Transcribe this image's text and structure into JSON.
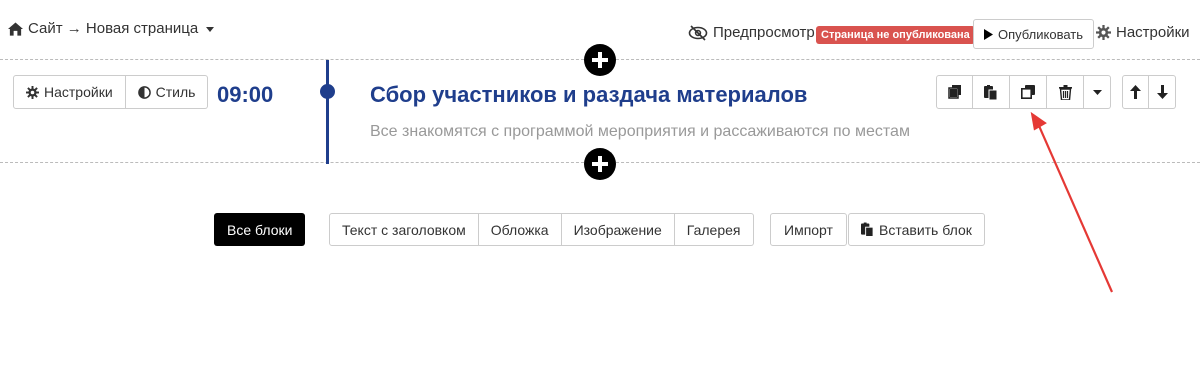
{
  "header": {
    "breadcrumb": "Сайт → Новая страница",
    "preview_label": "Предпросмотр",
    "status_badge": "Страница не опубликована",
    "publish_label": "Опубликовать",
    "settings_label": "Настройки"
  },
  "block": {
    "settings_label": "Настройки",
    "style_label": "Стиль",
    "time": "09:00",
    "title": "Сбор участников и раздача материалов",
    "subtitle": "Все знакомятся с программой мероприятия и рассаживаются по местам"
  },
  "block_tools": [
    "copy-icon",
    "paste-icon",
    "duplicate-icon",
    "trash-icon",
    "caret-down-icon",
    "arrow-up-icon",
    "arrow-down-icon"
  ],
  "library": {
    "all_blocks_label": "Все блоки",
    "categories": [
      "Текст с заголовком",
      "Обложка",
      "Изображение",
      "Галерея"
    ],
    "import_label": "Импорт",
    "paste_label": "Вставить блок"
  },
  "colors": {
    "accent": "#1f3e8c",
    "badge": "#d9534f",
    "arrow": "#e53935"
  }
}
